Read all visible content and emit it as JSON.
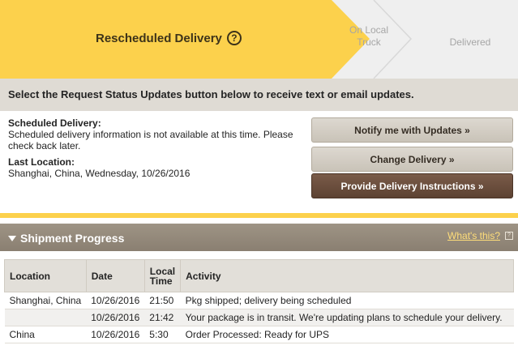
{
  "stepper": {
    "active_label": "Rescheduled Delivery",
    "active_help_icon": "question-circle-icon",
    "step2_line1": "On Local",
    "step2_line2": "Truck",
    "step3_label": "Delivered",
    "colors": {
      "active": "#fcd14c",
      "inactive": "#efefef",
      "inactive_text": "#a6a6a6"
    }
  },
  "banner": {
    "text": "Select the Request Status Updates button below to receive text or email updates."
  },
  "info": {
    "scheduled_label": "Scheduled Delivery:",
    "scheduled_text": "Scheduled delivery information is not available at this time. Please check back later.",
    "last_location_label": "Last Location:",
    "last_location_text": "Shanghai, China, Wednesday, 10/26/2016"
  },
  "buttons": {
    "notify": "Notify me with Updates »",
    "change": "Change Delivery »",
    "instructions": "Provide Delivery Instructions »"
  },
  "shipment_progress": {
    "title": "Shipment Progress",
    "whats_this": "What's this?",
    "table": {
      "headers": {
        "location": "Location",
        "date": "Date",
        "local_time_line1": "Local",
        "local_time_line2": "Time",
        "activity": "Activity"
      },
      "rows": [
        {
          "location": "Shanghai, China",
          "date": "10/26/2016",
          "time": "21:50",
          "activity": "Pkg shipped; delivery being scheduled"
        },
        {
          "location": "",
          "date": "10/26/2016",
          "time": "21:42",
          "activity": "Your package is in transit. We're updating plans to schedule your delivery."
        },
        {
          "location": "China",
          "date": "10/26/2016",
          "time": "5:30",
          "activity": "Order Processed: Ready for UPS"
        }
      ]
    }
  }
}
